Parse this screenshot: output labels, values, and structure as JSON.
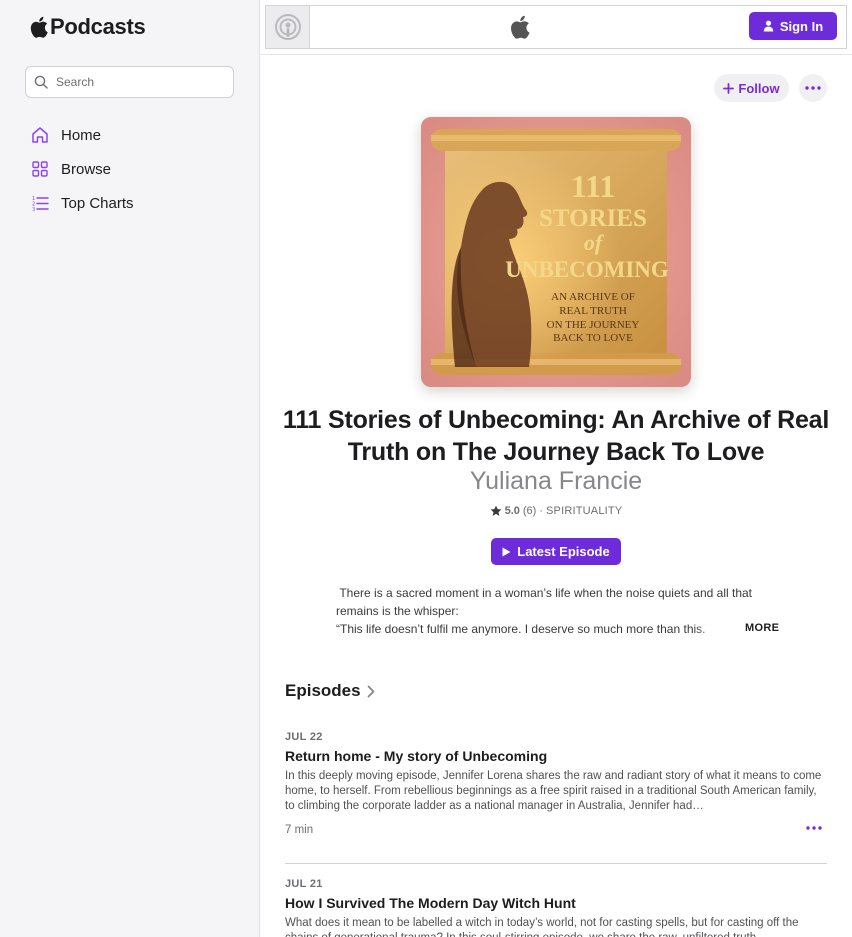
{
  "app": {
    "brand": "Podcasts",
    "accent_color": "#6e2bd9"
  },
  "sidebar": {
    "search_placeholder": "Search",
    "items": [
      {
        "label": "Home",
        "icon": "home-icon"
      },
      {
        "label": "Browse",
        "icon": "browse-grid-icon"
      },
      {
        "label": "Top Charts",
        "icon": "list-icon"
      }
    ]
  },
  "topbar": {
    "sign_in_label": "Sign In"
  },
  "podcast": {
    "follow_label": "Follow",
    "title": "111 Stories of Unbecoming: An Archive of Real Truth on The Journey Back To Love",
    "author": "Yuliana Francie",
    "rating": "5.0",
    "rating_count": "(6)",
    "separator": "·",
    "category": "SPIRITUALITY",
    "latest_episode_label": "Latest Episode",
    "description_line1": " There is a sacred moment in a woman’s life when the noise quiets and all that remains is the whisper:",
    "description_line2": " “This life doesn’t fulfil me anymore. I deserve so much more than this.",
    "more_label": "MORE",
    "artwork": {
      "line1": "111",
      "line2": "STORIES",
      "line3": "of",
      "line4": "UNBECOMING",
      "sub1": "AN ARCHIVE OF",
      "sub2": "REAL TRUTH",
      "sub3": "ON THE JOURNEY",
      "sub4": "BACK TO LOVE"
    }
  },
  "episodes": {
    "header": "Episodes",
    "items": [
      {
        "date": "JUL 22",
        "title": "Return home - My story of Unbecoming",
        "description": "In this deeply moving episode, Jennifer Lorena shares the raw and radiant story of what it means to come home, to herself.  From rebellious beginnings as a free spirit raised in a traditional South American family, to climbing the corporate ladder as a national manager in Australia, Jennifer had…",
        "duration": "7 min"
      },
      {
        "date": "JUL 21",
        "title": "How I Survived The Modern Day Witch Hunt",
        "description": "What does it mean to be labelled a witch in today’s world, not for casting spells, but for casting off the chains of generational trauma? In this soul-stirring episode, we share the raw, unfiltered truth…",
        "duration": ""
      }
    ]
  }
}
